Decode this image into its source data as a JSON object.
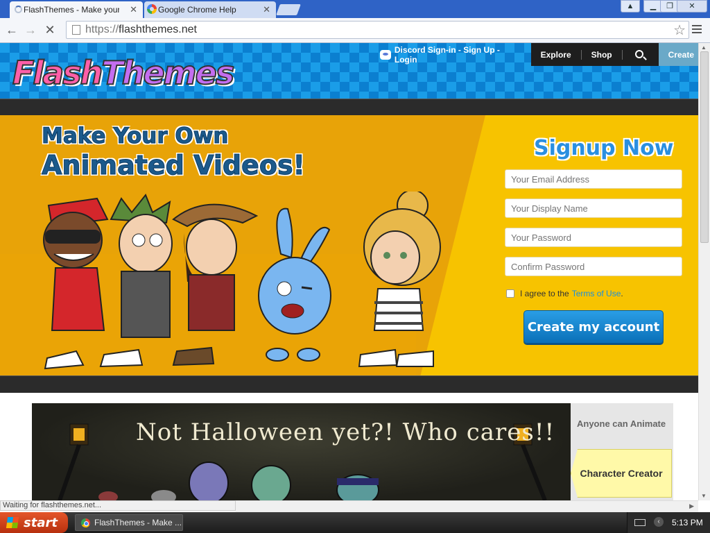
{
  "browser": {
    "tabs": [
      {
        "title": "FlashThemes - Make your ow",
        "active": true
      },
      {
        "title": "Google Chrome Help",
        "active": false
      }
    ],
    "url_scheme": "https://",
    "url_host": "flashthemes.net",
    "status_text": "Waiting for flashthemes.net..."
  },
  "site": {
    "logo": {
      "part1": "Flash",
      "part2": "Themes"
    },
    "nav": {
      "discord_label": "Discord Sign-in - Sign Up - Login",
      "explore": "Explore",
      "shop": "Shop",
      "create": "Create"
    },
    "hero": {
      "headline_line1": "Make Your Own",
      "headline_line2": "Animated Videos!"
    },
    "signup": {
      "title": "Signup Now",
      "email_placeholder": "Your Email Address",
      "display_name_placeholder": "Your Display Name",
      "password_placeholder": "Your Password",
      "confirm_placeholder": "Confirm Password",
      "agree_prefix": "I agree to the",
      "terms_link": "Terms of Use",
      "agree_suffix": ".",
      "submit_label": "Create my account"
    },
    "banner": {
      "title": "Not Halloween yet?! Who cares!!",
      "side_caption": "Anyone can Animate",
      "side_button": "Character Creator"
    }
  },
  "taskbar": {
    "start_label": "start",
    "task_label": "FlashThemes - Make ...",
    "clock": "5:13 PM"
  },
  "colors": {
    "hero_yellow": "#f7c300",
    "hero_orange": "#e8a308",
    "brand_blue": "#1a8fe0",
    "header_blue": "#1a9de8"
  }
}
